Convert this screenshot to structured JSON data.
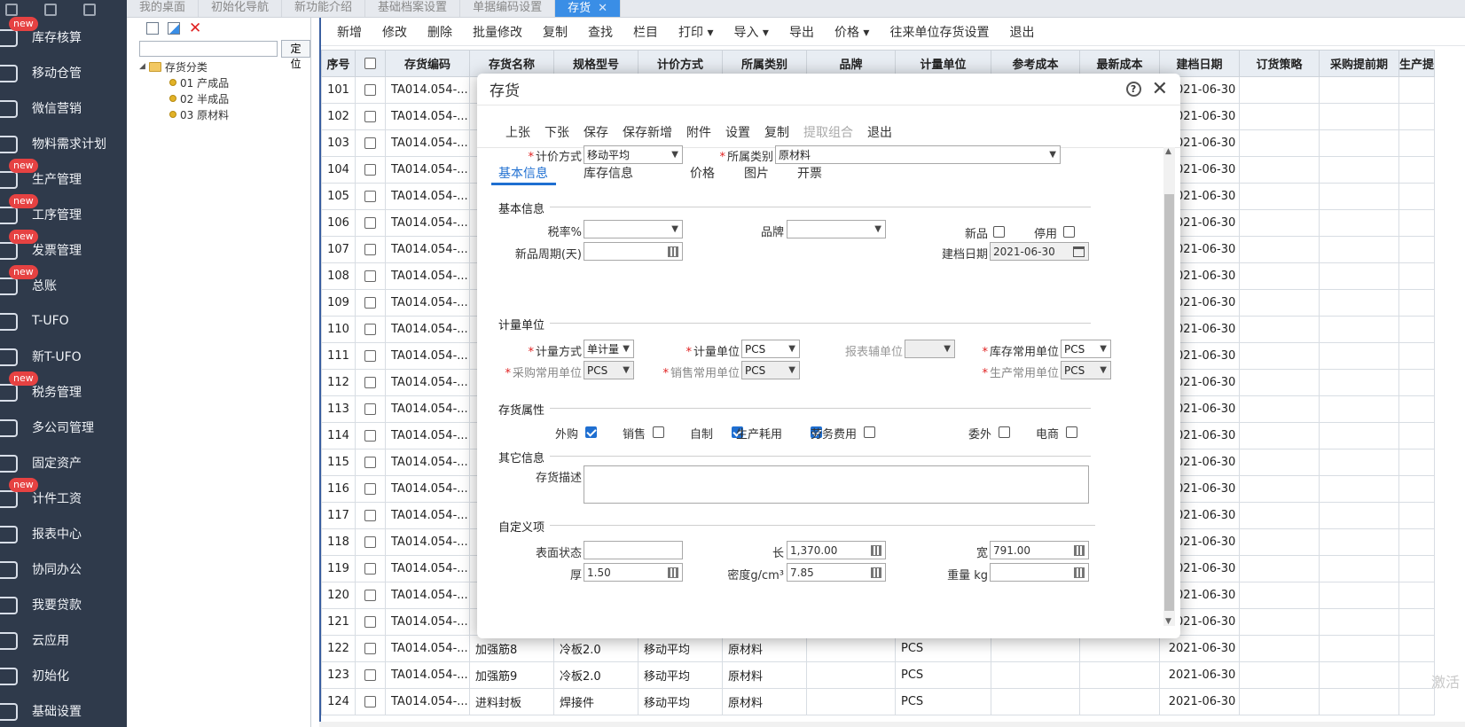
{
  "sidebar": {
    "items": [
      {
        "label": "库存核算",
        "badge": "new",
        "icon": "inventory-icon"
      },
      {
        "label": "移动仓管",
        "badge": "",
        "icon": "mobile-warehouse-icon"
      },
      {
        "label": "微信营销",
        "badge": "",
        "icon": "wechat-icon"
      },
      {
        "label": "物料需求计划",
        "badge": "",
        "icon": "mrp-icon"
      },
      {
        "label": "生产管理",
        "badge": "new",
        "icon": "production-icon"
      },
      {
        "label": "工序管理",
        "badge": "new",
        "icon": "process-icon"
      },
      {
        "label": "发票管理",
        "badge": "new",
        "icon": "invoice-icon"
      },
      {
        "label": "总账",
        "badge": "new",
        "icon": "ledger-icon"
      },
      {
        "label": "T-UFO",
        "badge": "",
        "icon": "ufo-icon"
      },
      {
        "label": "新T-UFO",
        "badge": "",
        "icon": "new-ufo-icon"
      },
      {
        "label": "税务管理",
        "badge": "new",
        "icon": "tax-icon"
      },
      {
        "label": "多公司管理",
        "badge": "",
        "icon": "company-icon"
      },
      {
        "label": "固定资产",
        "badge": "",
        "icon": "asset-icon"
      },
      {
        "label": "计件工资",
        "badge": "new",
        "icon": "payroll-icon"
      },
      {
        "label": "报表中心",
        "badge": "",
        "icon": "report-icon"
      },
      {
        "label": "协同办公",
        "badge": "",
        "icon": "office-icon"
      },
      {
        "label": "我要贷款",
        "badge": "",
        "icon": "loan-icon"
      },
      {
        "label": "云应用",
        "badge": "",
        "icon": "cloud-icon"
      },
      {
        "label": "初始化",
        "badge": "",
        "icon": "init-icon"
      },
      {
        "label": "基础设置",
        "badge": "",
        "icon": "settings-icon"
      }
    ]
  },
  "tabs": [
    {
      "label": "我的桌面",
      "active": false
    },
    {
      "label": "初始化导航",
      "active": false
    },
    {
      "label": "新功能介绍",
      "active": false
    },
    {
      "label": "基础档案设置",
      "active": false
    },
    {
      "label": "单据编码设置",
      "active": false
    },
    {
      "label": "存货",
      "active": true
    }
  ],
  "tree": {
    "locate_label": "定位",
    "search_value": "",
    "root": "存货分类",
    "children": [
      "01 产成品",
      "02 半成品",
      "03 原材料"
    ]
  },
  "toolbar": [
    "新增",
    "修改",
    "删除",
    "批量修改",
    "复制",
    "查找",
    "栏目",
    "打印 ▾",
    "导入 ▾",
    "导出",
    "价格 ▾",
    "往来单位存货设置",
    "退出"
  ],
  "grid": {
    "columns": [
      "序号",
      "",
      "存货编码",
      "存货名称",
      "规格型号",
      "计价方式",
      "所属类别",
      "品牌",
      "计量单位",
      "参考成本",
      "最新成本",
      "建档日期",
      "订货策略",
      "采购提前期",
      "生产提"
    ],
    "rows": [
      {
        "no": "101",
        "code": "TA014.054-...",
        "name": "",
        "spec": "",
        "price": "",
        "cat": "",
        "unit": "",
        "date": "2021-06-30"
      },
      {
        "no": "102",
        "code": "TA014.054-...",
        "name": "",
        "spec": "",
        "price": "",
        "cat": "",
        "unit": "",
        "date": "2021-06-30"
      },
      {
        "no": "103",
        "code": "TA014.054-...",
        "name": "",
        "spec": "",
        "price": "",
        "cat": "",
        "unit": "",
        "date": "2021-06-30"
      },
      {
        "no": "104",
        "code": "TA014.054-...",
        "name": "",
        "spec": "",
        "price": "",
        "cat": "",
        "unit": "",
        "date": "2021-06-30"
      },
      {
        "no": "105",
        "code": "TA014.054-...",
        "name": "",
        "spec": "",
        "price": "",
        "cat": "",
        "unit": "",
        "date": "2021-06-30"
      },
      {
        "no": "106",
        "code": "TA014.054-...",
        "name": "",
        "spec": "",
        "price": "",
        "cat": "",
        "unit": "",
        "date": "2021-06-30"
      },
      {
        "no": "107",
        "code": "TA014.054-...",
        "name": "",
        "spec": "",
        "price": "",
        "cat": "",
        "unit": "",
        "date": "2021-06-30"
      },
      {
        "no": "108",
        "code": "TA014.054-...",
        "name": "",
        "spec": "",
        "price": "",
        "cat": "",
        "unit": "",
        "date": "2021-06-30"
      },
      {
        "no": "109",
        "code": "TA014.054-...",
        "name": "",
        "spec": "",
        "price": "",
        "cat": "",
        "unit": "",
        "date": "2021-06-30"
      },
      {
        "no": "110",
        "code": "TA014.054-...",
        "name": "",
        "spec": "",
        "price": "",
        "cat": "",
        "unit": "",
        "date": "2021-06-30"
      },
      {
        "no": "111",
        "code": "TA014.054-...",
        "name": "",
        "spec": "",
        "price": "",
        "cat": "",
        "unit": "",
        "date": "2021-06-30"
      },
      {
        "no": "112",
        "code": "TA014.054-...",
        "name": "",
        "spec": "",
        "price": "",
        "cat": "",
        "unit": "",
        "date": "2021-06-30"
      },
      {
        "no": "113",
        "code": "TA014.054-...",
        "name": "",
        "spec": "",
        "price": "",
        "cat": "",
        "unit": "",
        "date": "2021-06-30"
      },
      {
        "no": "114",
        "code": "TA014.054-...",
        "name": "",
        "spec": "",
        "price": "",
        "cat": "",
        "unit": "",
        "date": "2021-06-30"
      },
      {
        "no": "115",
        "code": "TA014.054-...",
        "name": "",
        "spec": "",
        "price": "",
        "cat": "",
        "unit": "",
        "date": "2021-06-30"
      },
      {
        "no": "116",
        "code": "TA014.054-...",
        "name": "",
        "spec": "",
        "price": "",
        "cat": "",
        "unit": "",
        "date": "2021-06-30"
      },
      {
        "no": "117",
        "code": "TA014.054-...",
        "name": "",
        "spec": "",
        "price": "",
        "cat": "",
        "unit": "",
        "date": "2021-06-30"
      },
      {
        "no": "118",
        "code": "TA014.054-...",
        "name": "",
        "spec": "",
        "price": "",
        "cat": "",
        "unit": "",
        "date": "2021-06-30"
      },
      {
        "no": "119",
        "code": "TA014.054-...",
        "name": "",
        "spec": "",
        "price": "",
        "cat": "",
        "unit": "",
        "date": "2021-06-30"
      },
      {
        "no": "120",
        "code": "TA014.054-...",
        "name": "",
        "spec": "",
        "price": "",
        "cat": "",
        "unit": "",
        "date": "2021-06-30"
      },
      {
        "no": "121",
        "code": "TA014.054-...",
        "name": "",
        "spec": "",
        "price": "",
        "cat": "",
        "unit": "",
        "date": "2021-06-30"
      },
      {
        "no": "122",
        "code": "TA014.054-...",
        "name": "加强筋8",
        "spec": "冷板2.0",
        "price": "移动平均",
        "cat": "原材料",
        "unit": "PCS",
        "date": "2021-06-30"
      },
      {
        "no": "123",
        "code": "TA014.054-...",
        "name": "加强筋9",
        "spec": "冷板2.0",
        "price": "移动平均",
        "cat": "原材料",
        "unit": "PCS",
        "date": "2021-06-30"
      },
      {
        "no": "124",
        "code": "TA014.054-...",
        "name": "进料封板",
        "spec": "焊接件",
        "price": "移动平均",
        "cat": "原材料",
        "unit": "PCS",
        "date": "2021-06-30"
      }
    ]
  },
  "dialog": {
    "title": "存货",
    "tools": [
      {
        "label": "上张",
        "disabled": false
      },
      {
        "label": "下张",
        "disabled": false
      },
      {
        "label": "保存",
        "disabled": false
      },
      {
        "label": "保存新增",
        "disabled": false
      },
      {
        "label": "附件",
        "disabled": false
      },
      {
        "label": "设置",
        "disabled": false
      },
      {
        "label": "复制",
        "disabled": false
      },
      {
        "label": "提取组合",
        "disabled": true
      },
      {
        "label": "退出",
        "disabled": false
      }
    ],
    "pricing_label": "计价方式",
    "pricing_value": "移动平均",
    "category_label": "所属类别",
    "category_value": "原材料",
    "tabs": [
      "基本信息",
      "库存信息",
      "价格",
      "图片",
      "开票"
    ],
    "sec_basic": "基本信息",
    "tax_label": "税率%",
    "tax_value": "",
    "brand_label": "品牌",
    "brand_value": "",
    "new_label": "新品",
    "disabled_label": "停用",
    "cycle_label": "新品周期(天)",
    "cycle_value": "",
    "created_label": "建档日期",
    "created_value": "2021-06-30",
    "sec_unit": "计量单位",
    "unit_mode_label": "计量方式",
    "unit_mode_value": "单计量",
    "unit_label": "计量单位",
    "unit_value": "PCS",
    "report_unit_label": "报表辅单位",
    "report_unit_value": "",
    "stock_unit_label": "库存常用单位",
    "stock_unit_value": "PCS",
    "purchase_unit_label": "采购常用单位",
    "purchase_unit_value": "PCS",
    "sales_unit_label": "销售常用单位",
    "sales_unit_value": "PCS",
    "prod_unit_label": "生产常用单位",
    "prod_unit_value": "PCS",
    "sec_attr": "存货属性",
    "attrs": [
      {
        "label": "外购",
        "checked": true
      },
      {
        "label": "销售",
        "checked": false
      },
      {
        "label": "自制",
        "checked": true
      },
      {
        "label": "生产耗用",
        "checked": true
      },
      {
        "label": "劳务费用",
        "checked": false
      },
      {
        "label": "委外",
        "checked": false
      },
      {
        "label": "电商",
        "checked": false
      }
    ],
    "sec_other": "其它信息",
    "desc_label": "存货描述",
    "desc_value": "",
    "sec_custom": "自定义项",
    "surface_label": "表面状态",
    "surface_value": "",
    "length_label": "长",
    "length_value": "1,370.00",
    "width_label": "宽",
    "width_value": "791.00",
    "thick_label": "厚",
    "thick_value": "1.50",
    "density_label": "密度g/cm³",
    "density_value": "7.85",
    "weight_label": "重量 kg",
    "weight_value": ""
  },
  "watermark": "激活"
}
